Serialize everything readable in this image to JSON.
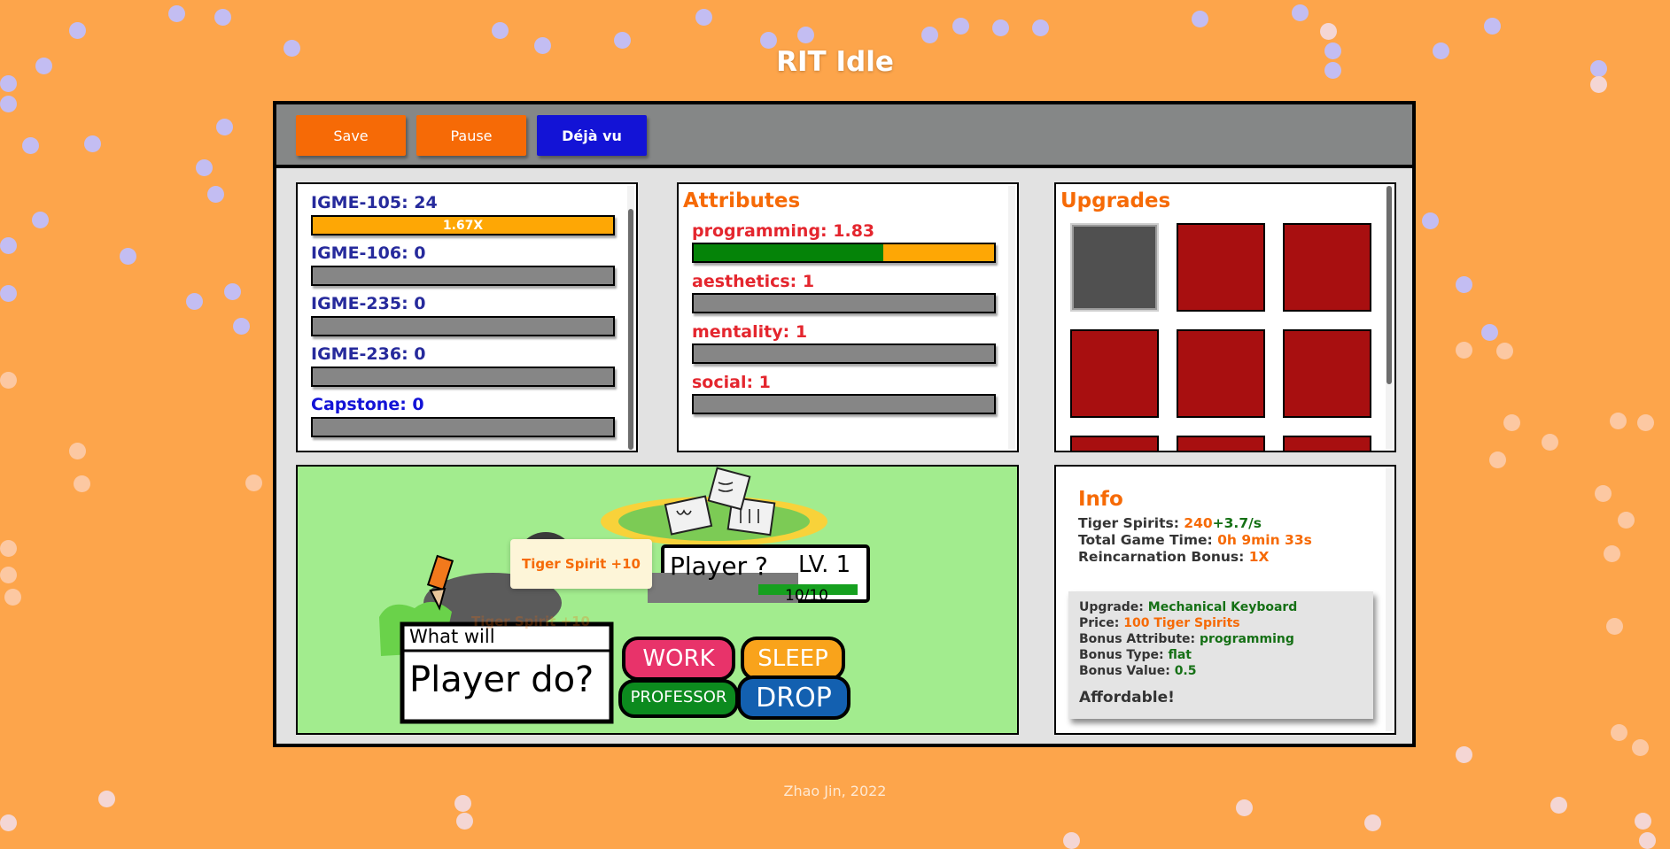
{
  "header": {
    "title": "RIT Idle"
  },
  "toolbar": {
    "save_label": "Save",
    "pause_label": "Pause",
    "dejavu_label": "Déjà vu"
  },
  "courses": [
    {
      "label": "IGME-105: 24",
      "progress": 1.0,
      "multiplier": "1.67X",
      "fill": "#fea705"
    },
    {
      "label": "IGME-106: 0",
      "progress": 0
    },
    {
      "label": "IGME-235: 0",
      "progress": 0
    },
    {
      "label": "IGME-236: 0",
      "progress": 0
    },
    {
      "label": "Capstone: 0",
      "progress": 0
    }
  ],
  "attributes": {
    "heading": "Attributes",
    "items": [
      {
        "label": "programming: 1.83",
        "progress": 0.63,
        "fill": "#058308",
        "remainder": "#fea705"
      },
      {
        "label": "aesthetics: 1",
        "progress": 0
      },
      {
        "label": "mentality: 1",
        "progress": 0
      },
      {
        "label": "social: 1",
        "progress": 0
      }
    ]
  },
  "upgrades": {
    "heading": "Upgrades",
    "tiles": [
      "owned",
      "locked",
      "locked",
      "locked",
      "locked",
      "locked",
      "locked",
      "locked",
      "locked"
    ]
  },
  "game": {
    "player_name": "Player ?",
    "level": "LV. 1",
    "hp_text": "10/10",
    "hp_fraction": 1.0,
    "prompt_top": "What will",
    "prompt_bottom": "Player do?",
    "actions": {
      "work": "WORK",
      "sleep": "SLEEP",
      "professor": "PROFESSOR",
      "drop": "DROP"
    },
    "popup": "Tiger Spirit +10",
    "popup_faded": "Tiger Spirit +10",
    "colors": {
      "work": "#e8336a",
      "sleep": "#f9a31b",
      "professor": "#0c8a1e",
      "drop": "#1360b0"
    }
  },
  "info": {
    "heading": "Info",
    "spirits_label": "Tiger Spirits: ",
    "spirits_value": "240",
    "spirits_rate": "+3.7/s",
    "time_label": "Total Game Time: ",
    "time_value": "0h 9min 33s",
    "reincarnation_label": "Reincarnation Bonus: ",
    "reincarnation_value": "1X",
    "card": {
      "upgrade_label": "Upgrade: ",
      "upgrade_value": "Mechanical Keyboard",
      "price_label": "Price: ",
      "price_value": "100 Tiger Spirits",
      "attribute_label": "Bonus Attribute: ",
      "attribute_value": "programming",
      "type_label": "Bonus Type: ",
      "type_value": "flat",
      "value_label": "Bonus Value: ",
      "value_value": "0.5",
      "status": "Affordable!"
    }
  },
  "footer": {
    "credit": "Zhao Jin, 2022"
  }
}
